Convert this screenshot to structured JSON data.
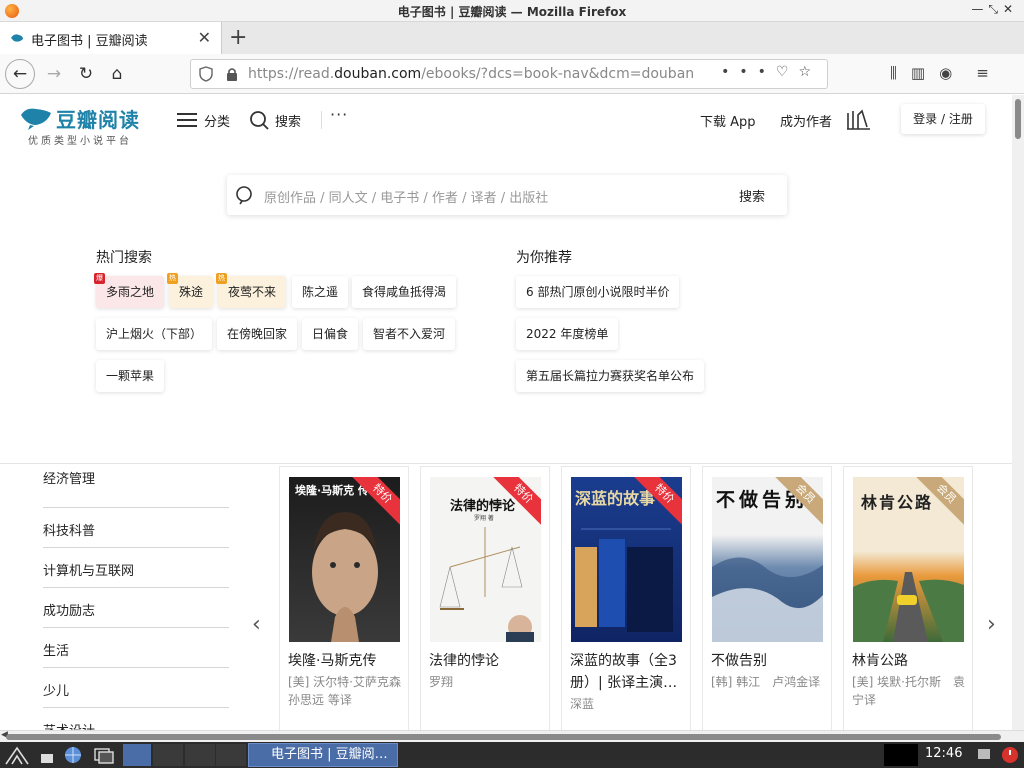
{
  "window": {
    "title": "电子图书 | 豆瓣阅读 — Mozilla Firefox"
  },
  "tab": {
    "label": "电子图书 | 豆瓣阅读",
    "close": "✕",
    "new_tab": "+"
  },
  "urlbar": {
    "scheme": "https://read.",
    "domain": "douban.com",
    "path": "/ebooks/?dcs=book-nav&dcm=douban",
    "more": "•••"
  },
  "site": {
    "logo_name": "豆瓣阅读",
    "logo_slogan": "优质类型小说平台",
    "nav": {
      "category": "分类",
      "search": "搜索",
      "more": "···",
      "download": "下载 App",
      "author": "成为作者",
      "login": "登录 / 注册"
    }
  },
  "search": {
    "placeholder": "原创作品 / 同人文 / 电子书 / 作者 / 译者 / 出版社",
    "button": "搜索"
  },
  "hot": {
    "title": "热门搜索",
    "tags": [
      {
        "label": "多雨之地",
        "badge": "爆"
      },
      {
        "label": "殊途",
        "badge": "热"
      },
      {
        "label": "夜莺不来",
        "badge": "热"
      },
      {
        "label": "陈之遥",
        "badge": ""
      },
      {
        "label": "食得咸鱼抵得渴",
        "badge": ""
      },
      {
        "label": "沪上烟火（下部）",
        "badge": ""
      },
      {
        "label": "在傍晚回家",
        "badge": ""
      },
      {
        "label": "日偏食",
        "badge": ""
      },
      {
        "label": "智者不入爱河",
        "badge": ""
      },
      {
        "label": "一颗苹果",
        "badge": ""
      }
    ]
  },
  "recommend": {
    "title": "为你推荐",
    "items": [
      "6 部热门原创小说限时半价",
      "2022 年度榜单",
      "第五届长篇拉力赛获奖名单公布"
    ]
  },
  "categories": [
    "经济管理",
    "科技科普",
    "计算机与互联网",
    "成功励志",
    "生活",
    "少儿",
    "艺术设计"
  ],
  "carousel": {
    "prev": "‹",
    "next": "›"
  },
  "books": [
    {
      "title": "埃隆·马斯克传",
      "author": "[美] 沃尔特·艾萨克森 孙思远 等译",
      "ribbon": "特价",
      "cover_text": "埃隆·马斯克 传"
    },
    {
      "title": "法律的悖论",
      "author": "罗翔",
      "ribbon": "特价",
      "cover_text": "法律的悖论",
      "cover_sub": "罗翔 著"
    },
    {
      "title": "深蓝的故事（全3册）| 张译主演…",
      "author": "深蓝",
      "ribbon": "特价",
      "cover_text": "深蓝的故事"
    },
    {
      "title": "不做告别",
      "author": "[韩] 韩江　卢鸿金译",
      "ribbon": "会员",
      "cover_text": "不做告别"
    },
    {
      "title": "林肯公路",
      "author": "[美] 埃默·托尔斯　袁宁译",
      "ribbon": "会员",
      "cover_text": "林肯公路"
    }
  ],
  "taskbar": {
    "app_label": "电子图书 | 豆瓣阅…",
    "clock": "12:46"
  },
  "colors": {
    "accent": "#1f82a8",
    "special_ribbon": "#e8323c",
    "member_ribbon": "#c9a97a"
  }
}
